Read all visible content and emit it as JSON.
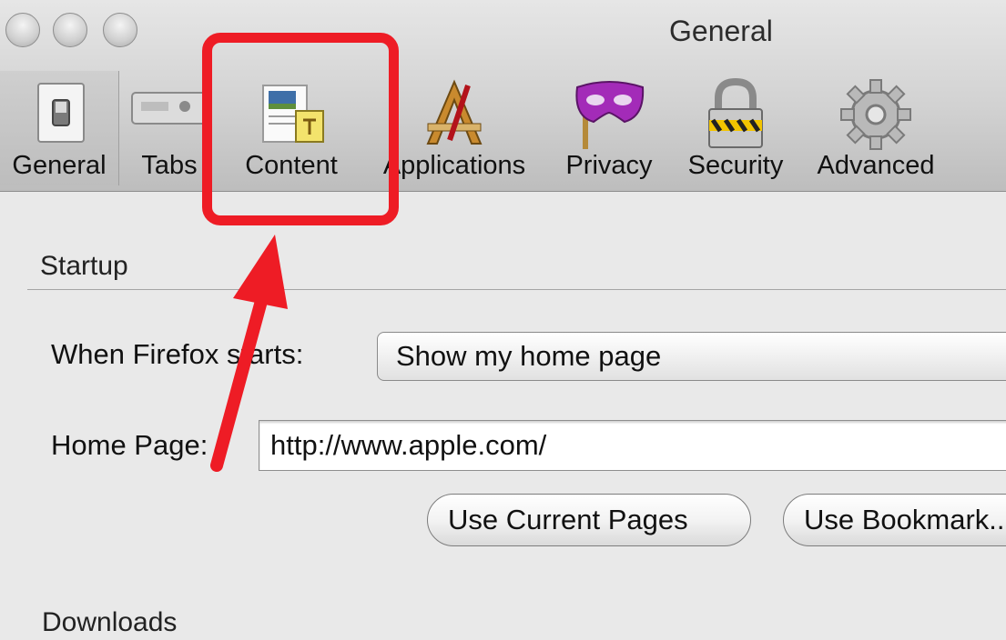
{
  "window": {
    "title": "General"
  },
  "toolbar": {
    "items": [
      {
        "label": "General",
        "icon": "general-switch-icon",
        "selected": true
      },
      {
        "label": "Tabs",
        "icon": "tabs-icon"
      },
      {
        "label": "Content",
        "icon": "content-icon"
      },
      {
        "label": "Applications",
        "icon": "applications-icon"
      },
      {
        "label": "Privacy",
        "icon": "privacy-mask-icon"
      },
      {
        "label": "Security",
        "icon": "security-lock-icon"
      },
      {
        "label": "Advanced",
        "icon": "advanced-gear-icon"
      }
    ]
  },
  "startup": {
    "title": "Startup",
    "when_starts_label": "When Firefox starts:",
    "when_starts_value": "Show my home page",
    "home_page_label": "Home Page:",
    "home_page_value": "http://www.apple.com/",
    "use_current_pages_label": "Use Current Pages",
    "use_bookmark_label": "Use Bookmark..."
  },
  "downloads": {
    "title": "Downloads"
  },
  "colors": {
    "highlight": "#ee1c25",
    "arrow": "#ee1c25"
  }
}
